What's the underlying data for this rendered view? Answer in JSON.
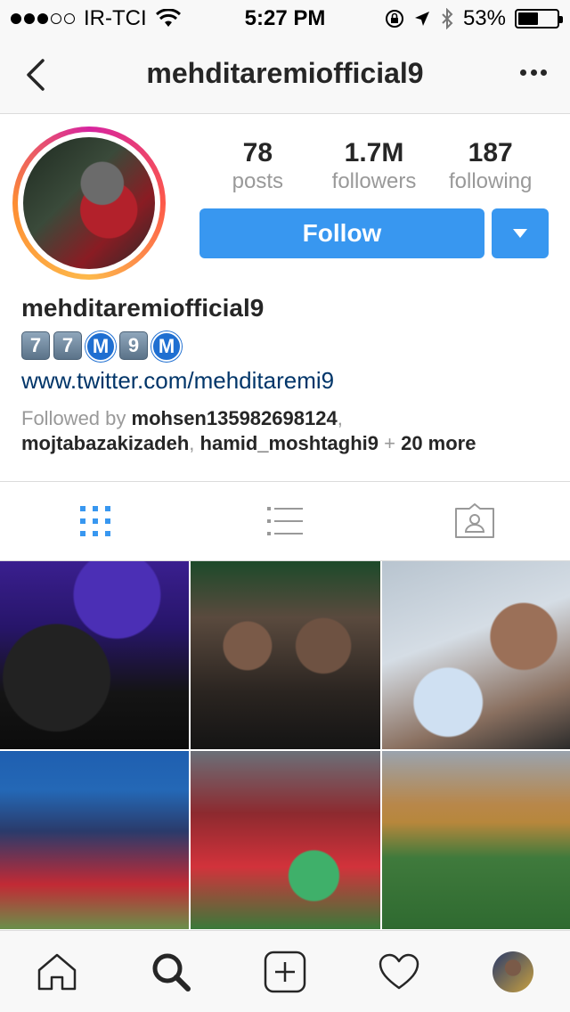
{
  "status_bar": {
    "carrier": "IR-TCI",
    "time": "5:27 PM",
    "battery_percent": "53%",
    "battery_level": 0.53
  },
  "nav": {
    "title": "mehditaremiofficial9"
  },
  "profile": {
    "stats": [
      {
        "value": "78",
        "label": "posts"
      },
      {
        "value": "1.7M",
        "label": "followers"
      },
      {
        "value": "187",
        "label": "following"
      }
    ],
    "follow_label": "Follow",
    "name": "mehditaremiofficial9",
    "bio_emoji": [
      "7",
      "7",
      "M",
      "9",
      "M"
    ],
    "link": "www.twitter.com/mehditaremi9",
    "followed_by": {
      "prefix": "Followed by ",
      "users": [
        "mohsen135982698124",
        "mojtabazakizadeh",
        "hamid_moshtaghi9"
      ],
      "plus": " + ",
      "more": "20 more"
    }
  },
  "view_tabs": [
    "grid-view",
    "list-view",
    "tagged-view"
  ],
  "active_view_color": "#3897f0",
  "tab_bar": [
    "home",
    "search",
    "add",
    "activity",
    "profile"
  ]
}
